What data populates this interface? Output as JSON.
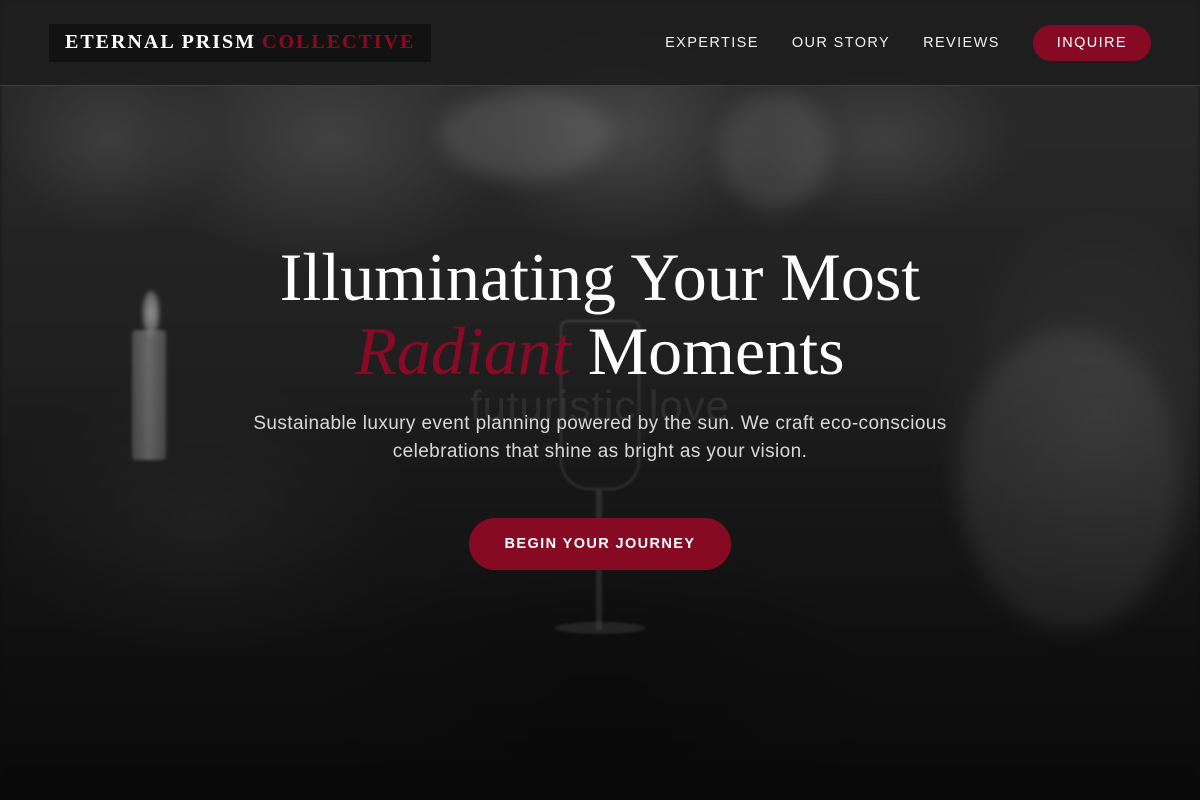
{
  "brand": {
    "name_primary": "ETERNAL PRISM",
    "name_accent": "COLLECTIVE"
  },
  "nav": {
    "items": [
      {
        "label": "EXPERTISE"
      },
      {
        "label": "OUR STORY"
      },
      {
        "label": "REVIEWS"
      }
    ],
    "inquire_label": "INQUIRE"
  },
  "hero": {
    "title_line1": "Illuminating Your Most",
    "title_highlight": "Radiant",
    "title_line2_rest": "Moments",
    "ghost_text": "futuristic love",
    "subtitle": "Sustainable luxury event planning powered by the sun. We craft eco-conscious celebrations that shine as bright as your vision.",
    "cta_label": "BEGIN YOUR JOURNEY"
  },
  "colors": {
    "accent": "#870a25",
    "header_bg": "#1c1c1c",
    "text": "#ffffff"
  }
}
